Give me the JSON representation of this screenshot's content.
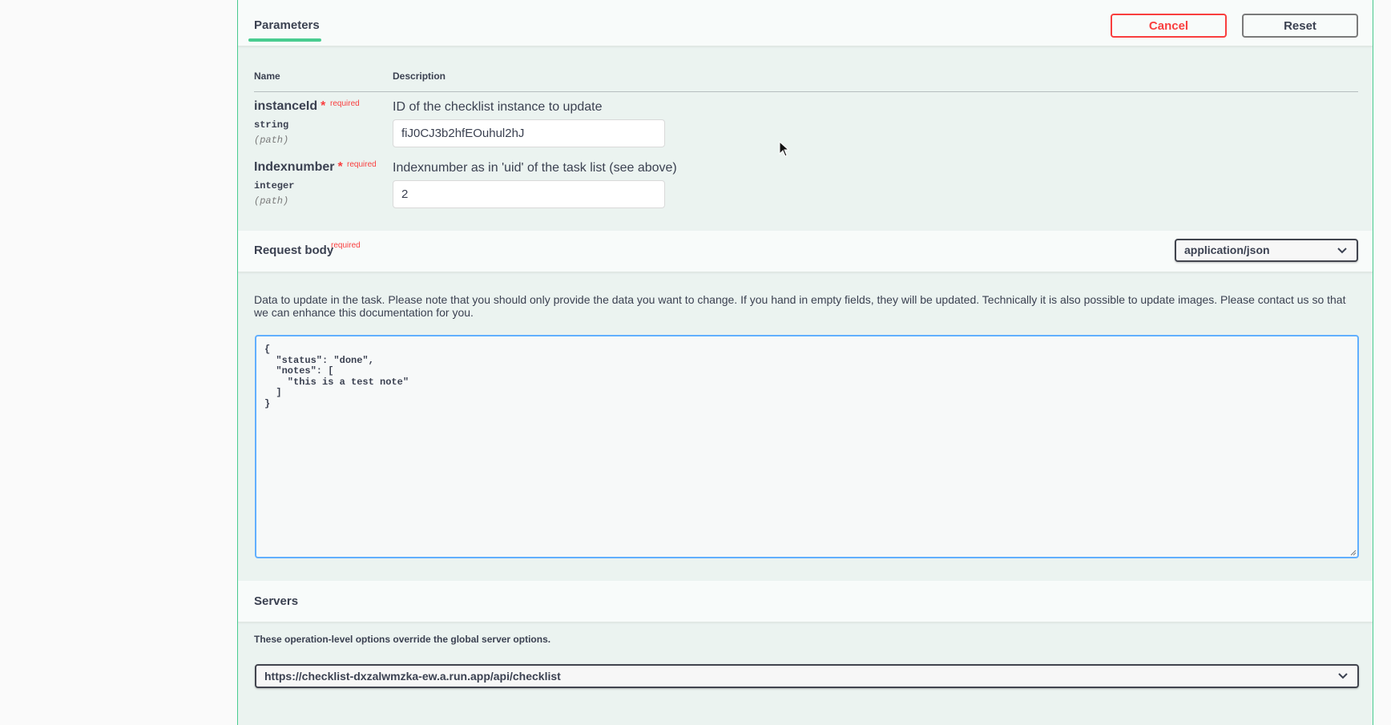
{
  "parameters_tab": {
    "label": "Parameters"
  },
  "actions": {
    "cancel_label": "Cancel",
    "reset_label": "Reset"
  },
  "table": {
    "name_header": "Name",
    "description_header": "Description",
    "required_label": "required",
    "rows": [
      {
        "name": "instanceId",
        "type": "string",
        "location": "(path)",
        "description": "ID of the checklist instance to update",
        "value": "fiJ0CJ3b2hfEOuhul2hJ"
      },
      {
        "name": "Indexnumber",
        "type": "integer",
        "location": "(path)",
        "description": "Indexnumber as in 'uid' of the task list (see above)",
        "value": "2"
      }
    ]
  },
  "request_body": {
    "title": "Request body",
    "required_label": "required",
    "content_type": "application/json",
    "description": "Data to update in the task. Please note that you should only provide the data you want to change. If you hand in empty fields, they will be updated. Technically it is also possible to update images. Please contact us so that we can enhance this documentation for you.",
    "body": "{\n  \"status\": \"done\",\n  \"notes\": [\n    \"this is a test note\"\n  ]\n}"
  },
  "servers": {
    "title": "Servers",
    "description": "These operation-level options override the global server options.",
    "selected": "https://checklist-dxzalwmzka-ew.a.run.app/api/checklist"
  },
  "colors": {
    "accent_green": "#49cc90",
    "cancel_red": "#f93e3e",
    "editor_blue": "#61affe",
    "panel_bg": "#ebf3f0"
  },
  "icons": {
    "select_chevron": "chevron-down-icon",
    "mouse_cursor": "pointer-cursor-icon",
    "resize": "resize-handle-icon"
  }
}
